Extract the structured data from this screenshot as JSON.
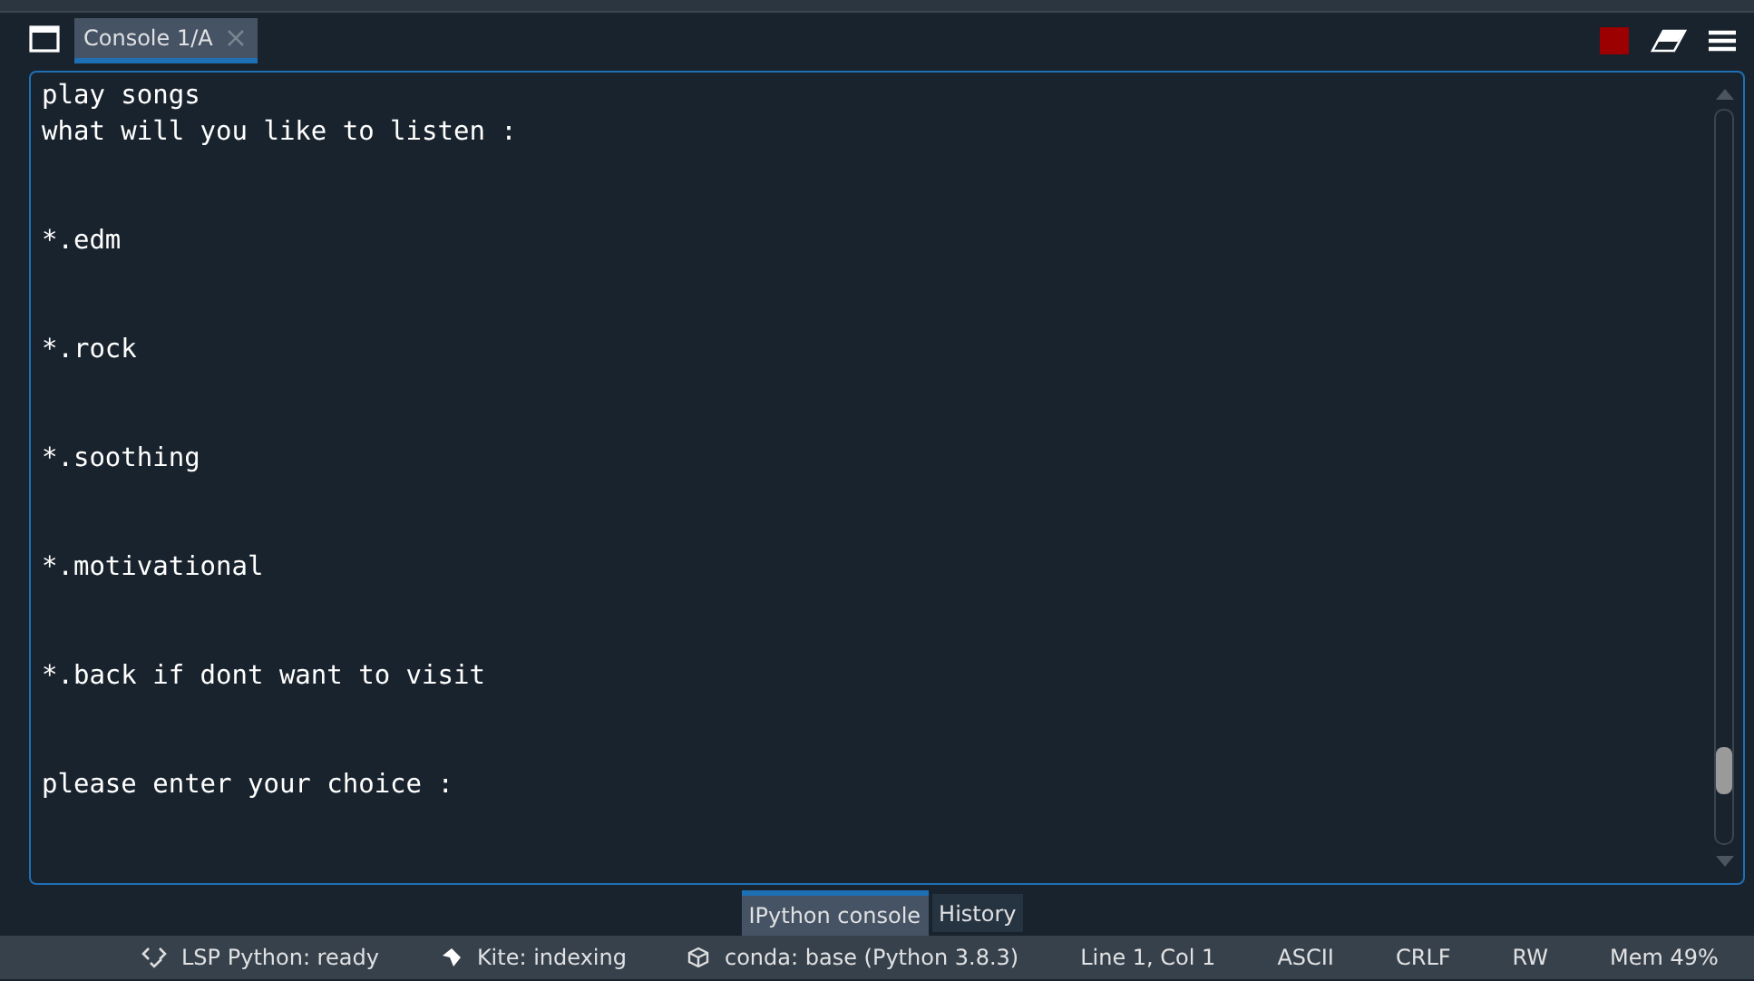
{
  "tabs": [
    {
      "label": "Console 1/A",
      "selected": true,
      "closable": true
    }
  ],
  "console": {
    "blocks": [
      [
        "play songs",
        "what will you like to listen :"
      ],
      [
        "*.edm"
      ],
      [
        "*.rock"
      ],
      [
        "*.soothing"
      ],
      [
        "*.motivational"
      ],
      [
        "*.back if dont want to visit"
      ],
      [
        "please enter your choice :"
      ]
    ]
  },
  "bottom_tabs": [
    {
      "label": "IPython console",
      "selected": true
    },
    {
      "label": "History",
      "selected": false
    }
  ],
  "status_bar": [
    {
      "kind": "lsp",
      "text": "LSP Python: ready"
    },
    {
      "kind": "kite",
      "text": "Kite: indexing"
    },
    {
      "kind": "conda",
      "text": "conda: base (Python 3.8.3)"
    },
    {
      "kind": "plain",
      "text": "Line 1, Col 1"
    },
    {
      "kind": "plain",
      "text": "ASCII"
    },
    {
      "kind": "plain",
      "text": "CRLF"
    },
    {
      "kind": "plain",
      "text": "RW"
    },
    {
      "kind": "plain",
      "text": "Mem 49%"
    }
  ]
}
